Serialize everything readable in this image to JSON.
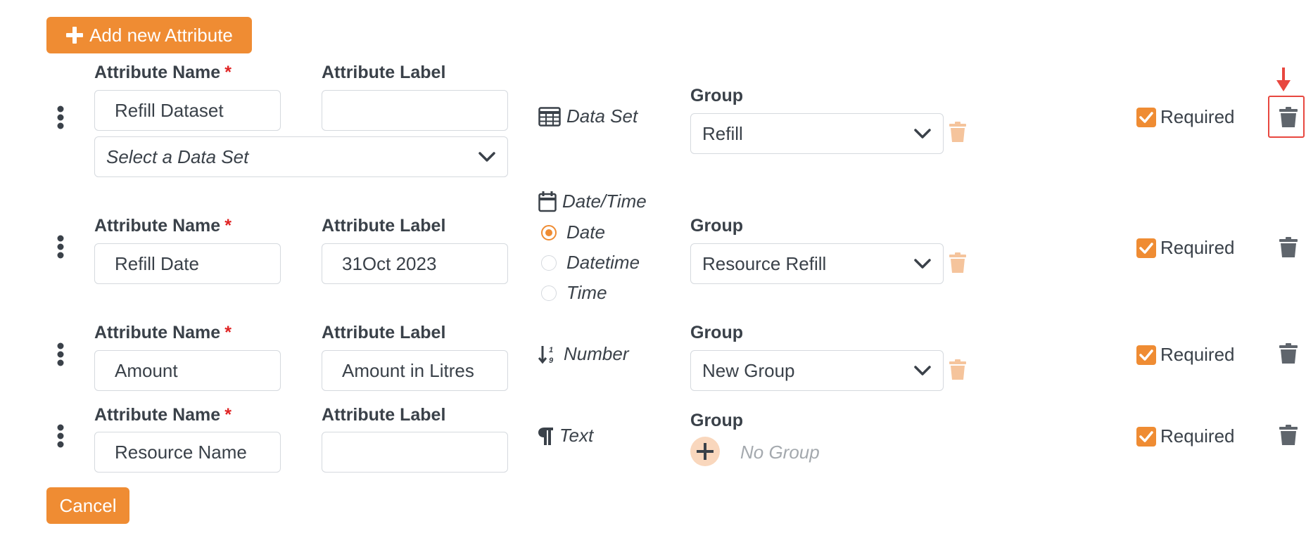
{
  "toolbar": {
    "add_label": "Add new Attribute",
    "cancel_label": "Cancel"
  },
  "common": {
    "attribute_name_label": "Attribute Name",
    "required_star": "*",
    "attribute_label_label": "Attribute Label",
    "group_label": "Group",
    "required_label": "Required"
  },
  "attributes": [
    {
      "name": "Refill Dataset",
      "label": "",
      "type": "Data Set",
      "dataset_placeholder": "Select a Data Set",
      "group": "Refill",
      "required": true
    },
    {
      "name": "Refill Date",
      "label": "31Oct 2023",
      "type": "Date/Time",
      "options": [
        {
          "label": "Date",
          "checked": true
        },
        {
          "label": "Datetime",
          "checked": false
        },
        {
          "label": "Time",
          "checked": false
        }
      ],
      "group": "Resource Refill",
      "required": true
    },
    {
      "name": "Amount",
      "label": "Amount in Litres",
      "type": "Number",
      "group": "New Group",
      "required": true
    },
    {
      "name": "Resource Name",
      "label": "",
      "type": "Text",
      "group_empty": "No Group",
      "required": true
    }
  ],
  "colors": {
    "accent": "#ef8c33",
    "accent_light": "#f5c49c",
    "annotation": "#e8473f",
    "text": "#3a4149",
    "icon_gray": "#5f656c"
  },
  "icons": [
    "plus-icon",
    "drag-handle-icon",
    "table-icon",
    "calendar-icon",
    "sort-numeric-icon",
    "pilcrow-icon",
    "chevron-down-icon",
    "trash-icon",
    "check-icon",
    "red-arrow-icon"
  ]
}
